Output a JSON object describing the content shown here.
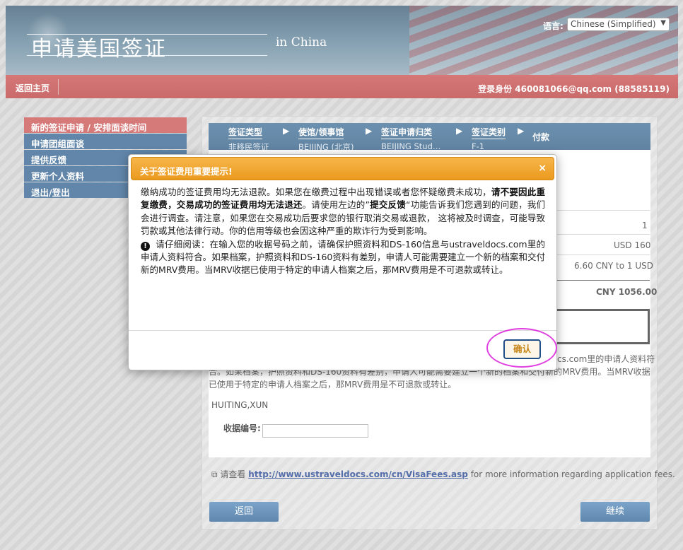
{
  "header": {
    "site_title": "申请美国签证",
    "site_subtitle": "in China",
    "language_label": "语言:",
    "language_value": "Chinese (Simplified)"
  },
  "topbar": {
    "home_link": "返回主页",
    "login_label": "登录身份",
    "login_value": "460081066@qq.com (88585119)"
  },
  "sidebar": {
    "items": [
      {
        "label": "新的签证申请 / 安排面谈时间",
        "active": true
      },
      {
        "label": "申请团组面谈",
        "active": false
      },
      {
        "label": "提供反馈",
        "active": false
      },
      {
        "label": "更新个人资料",
        "active": false
      },
      {
        "label": "退出/登出",
        "active": false
      }
    ]
  },
  "steps": [
    {
      "title": "签证类型",
      "value": "非移民签证"
    },
    {
      "title": "使馆/领事馆",
      "value": "BEIJING (北京)"
    },
    {
      "title": "签证申请归类",
      "value": "BEIJING Stud…"
    },
    {
      "title": "签证类别",
      "value": "F-1"
    },
    {
      "title": "付款",
      "value": ""
    }
  ],
  "fees": {
    "count": "1",
    "fee_usd": "USD 160",
    "exchange_rate": "6.60 CNY to 1 USD",
    "total": "CNY 1056.00"
  },
  "page_note": {
    "line1_tail": "cs.com里的申请人资料符",
    "line2": "合。如果档案，护照资料和DS-160资料有差别，申请人可能需要建立一个新的档案和交付新的MRV费用。当MRV收据",
    "line3": "已使用于特定的申请人档案之后，那MRV费用是不可退款或转让。"
  },
  "applicant_name": "HUITING,XUN",
  "receipt": {
    "label": "收据编号:",
    "value": ""
  },
  "fee_info": {
    "prefix": "请查看",
    "link": "http://www.ustraveldocs.com/cn/VisaFees.asp",
    "suffix": "for more information regarding application fees."
  },
  "buttons": {
    "back": "返回",
    "continue": "继续"
  },
  "modal": {
    "title": "关于签证费用重要提示!",
    "close": "×",
    "p1_a": "缴纳成功的签证费用均无法退款。如果您在缴费过程中出现错误或者您怀疑缴费未成功，",
    "p1_bold": "请不要因此重复缴费，交易成功的签证费用均无法退还",
    "p1_b": "。请使用左边的”",
    "p1_feedback": "提交反馈",
    "p1_c": "“功能告诉我们您遇到的问题，我们会进行调查。请注意，如果您在交易成功后要求您的银行取消交易或退款， 这将被及时调查，可能导致罚款或其他法律行动。你的信用等级也会因这种严重的欺诈行为受到影响。",
    "p2": "请仔细阅读：在输入您的收据号码之前，请确保护照资料和DS-160信息与ustraveldocs.com里的申请人资料符合。如果档案，护照资料和DS-160资料有差别，申请人可能需要建立一个新的档案和交付新的MRV费用。当MRV收据已使用于特定的申请人档案之后，那MRV费用是不可退款或转让。",
    "confirm": "确认"
  },
  "colors": {
    "modal_header": "#eb9a1f",
    "nav_active": "#c84d4d",
    "nav_item": "#2d5e8e",
    "highlight": "#e040e0"
  }
}
